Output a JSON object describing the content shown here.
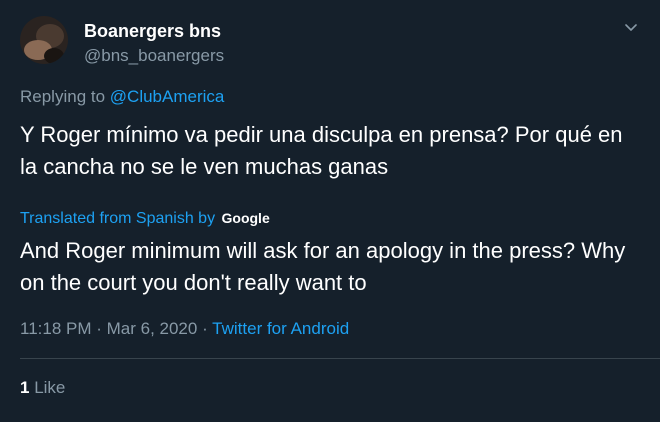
{
  "author": {
    "display_name": "Boanergers bns",
    "handle": "@bns_boanergers"
  },
  "reply": {
    "prefix": "Replying to ",
    "mention": "@ClubAmerica"
  },
  "tweet": {
    "original_text": "Y Roger mínimo va pedir una disculpa en prensa? Por qué en la cancha no se le ven muchas ganas",
    "translated_from": "Translated from Spanish",
    "translated_by": " by ",
    "translation_provider": "Google",
    "translation_text": "And Roger minimum will ask for an apology in the press? Why on the court you don't really want to"
  },
  "meta": {
    "time": "11:18 PM",
    "separator": " · ",
    "date": "Mar 6, 2020",
    "source": "Twitter for Android"
  },
  "stats": {
    "like_count": "1",
    "like_label": " Like"
  },
  "colors": {
    "background": "#15202b",
    "accent": "#1da1f2",
    "muted": "#8899a6",
    "divider": "#38444d"
  }
}
